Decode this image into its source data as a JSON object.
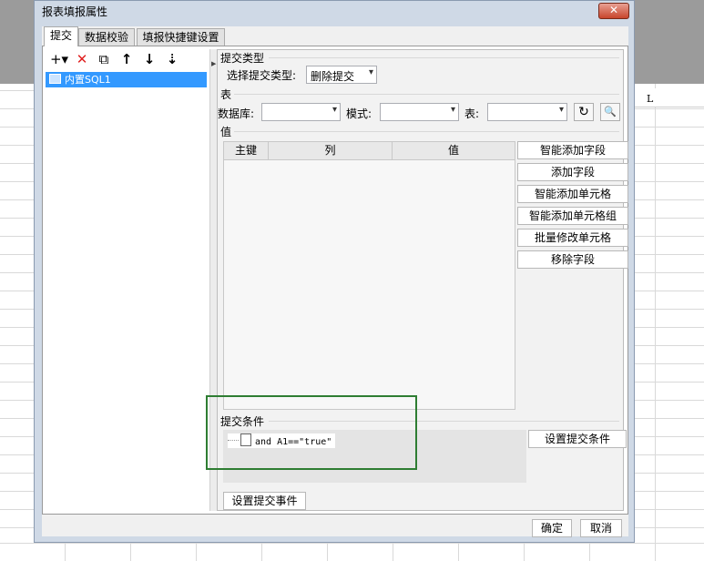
{
  "window": {
    "title": "报表填报属性",
    "close_label": "✕"
  },
  "background": {
    "column_letter": "L"
  },
  "tabs": [
    {
      "label": "提交"
    },
    {
      "label": "数据校验"
    },
    {
      "label": "填报快捷键设置"
    }
  ],
  "toolbar": {
    "add": "+▾",
    "delete": "✕",
    "copy": "⧉",
    "up": "↑",
    "down": "↓",
    "sort": "⇣"
  },
  "tree": {
    "items": [
      {
        "label": "内置SQL1"
      }
    ]
  },
  "submit_type": {
    "section_label": "提交类型",
    "select_label": "选择提交类型:",
    "value": "删除提交"
  },
  "table_section": {
    "section_label": "表",
    "database_label": "数据库:",
    "schema_label": "模式:",
    "table_label": "表:",
    "refresh_icon": "↻",
    "preview_icon": "🔍"
  },
  "value_section": {
    "section_label": "值",
    "columns": [
      "主键",
      "列",
      "值"
    ],
    "buttons": [
      "智能添加字段",
      "添加字段",
      "智能添加单元格",
      "智能添加单元格组",
      "批量修改单元格",
      "移除字段"
    ]
  },
  "condition_section": {
    "section_label": "提交条件",
    "condition": "and A1==\"true\"",
    "set_button": "设置提交条件"
  },
  "event_button": "设置提交事件",
  "footer": {
    "ok": "确定",
    "cancel": "取消"
  }
}
